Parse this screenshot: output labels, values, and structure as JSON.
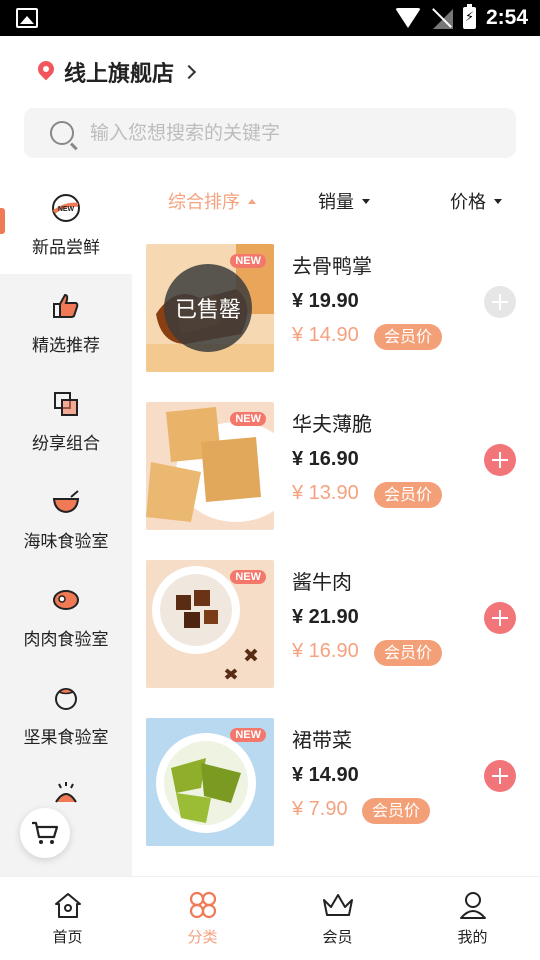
{
  "status_bar": {
    "time": "2:54"
  },
  "header": {
    "store_name": "线上旗舰店"
  },
  "search": {
    "placeholder": "输入您想搜索的关键字"
  },
  "sidebar": {
    "items": [
      {
        "label": "新品尝鲜",
        "icon": "new-badge-icon",
        "active": true
      },
      {
        "label": "精选推荐",
        "icon": "thumbs-up-icon"
      },
      {
        "label": "纷享组合",
        "icon": "combo-icon"
      },
      {
        "label": "海味食验室",
        "icon": "seafood-bowl-icon"
      },
      {
        "label": "肉肉食验室",
        "icon": "meat-icon"
      },
      {
        "label": "坚果食验室",
        "icon": "nut-icon"
      }
    ]
  },
  "sort": {
    "overall": "综合排序",
    "sales": "销量",
    "price": "价格"
  },
  "products": [
    {
      "name": "去骨鸭掌",
      "price": "¥ 19.90",
      "member_price": "¥ 14.90",
      "member_tag": "会员价",
      "badge": "NEW",
      "soldout": "已售罄"
    },
    {
      "name": "华夫薄脆",
      "price": "¥ 16.90",
      "member_price": "¥ 13.90",
      "member_tag": "会员价",
      "badge": "NEW"
    },
    {
      "name": "酱牛肉",
      "price": "¥ 21.90",
      "member_price": "¥ 16.90",
      "member_tag": "会员价",
      "badge": "NEW"
    },
    {
      "name": "裙带菜",
      "price": "¥ 14.90",
      "member_price": "¥ 7.90",
      "member_tag": "会员价",
      "badge": "NEW"
    }
  ],
  "bottom_nav": [
    {
      "label": "首页",
      "icon": "home-icon"
    },
    {
      "label": "分类",
      "icon": "category-icon",
      "active": true
    },
    {
      "label": "会员",
      "icon": "crown-icon"
    },
    {
      "label": "我的",
      "icon": "profile-icon"
    }
  ],
  "colors": {
    "accent": "#f4a27f",
    "add_button": "#f2757a",
    "pin": "#f2565c"
  }
}
